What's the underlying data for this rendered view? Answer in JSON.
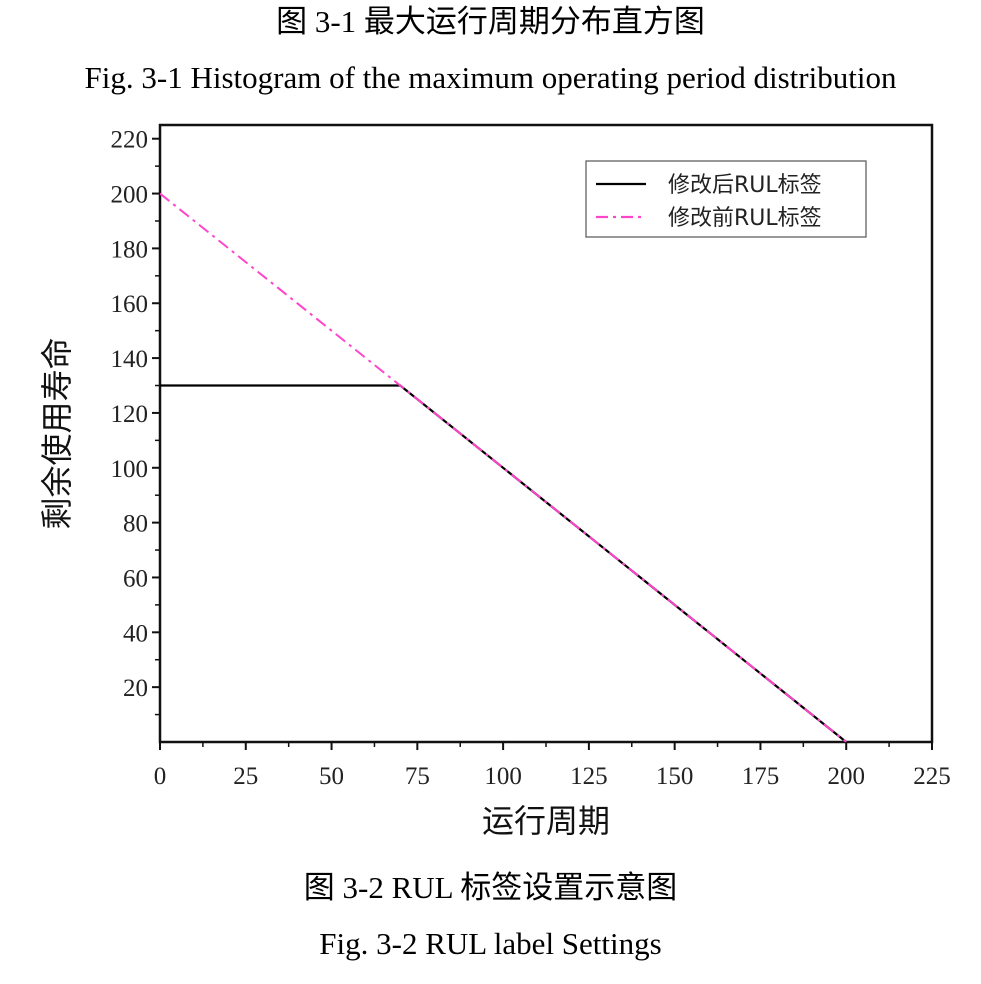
{
  "captions": {
    "top_cn": "图 3-1  最大运行周期分布直方图",
    "top_en": "Fig. 3-1 Histogram of the maximum operating period distribution",
    "bottom_cn": "图 3-2 RUL 标签设置示意图",
    "bottom_en": "Fig. 3-2 RUL label Settings"
  },
  "chart_data": {
    "type": "line",
    "title": "",
    "xlabel": "运行周期",
    "ylabel": "剩余使用寿命",
    "xlim": [
      0,
      225
    ],
    "ylim": [
      0,
      225
    ],
    "xticks": [
      0,
      25,
      50,
      75,
      100,
      125,
      150,
      175,
      200,
      225
    ],
    "yticks": [
      20,
      40,
      60,
      80,
      100,
      120,
      140,
      160,
      180,
      200,
      220
    ],
    "grid": false,
    "legend_position": "top-right",
    "series": [
      {
        "name": "修改后RUL标签",
        "color": "#000000",
        "style": "solid",
        "x": [
          0,
          70,
          200
        ],
        "y": [
          130,
          130,
          0
        ]
      },
      {
        "name": "修改前RUL标签",
        "color": "#ff44cc",
        "style": "dash-dot",
        "x": [
          0,
          200
        ],
        "y": [
          200,
          0
        ]
      }
    ]
  }
}
